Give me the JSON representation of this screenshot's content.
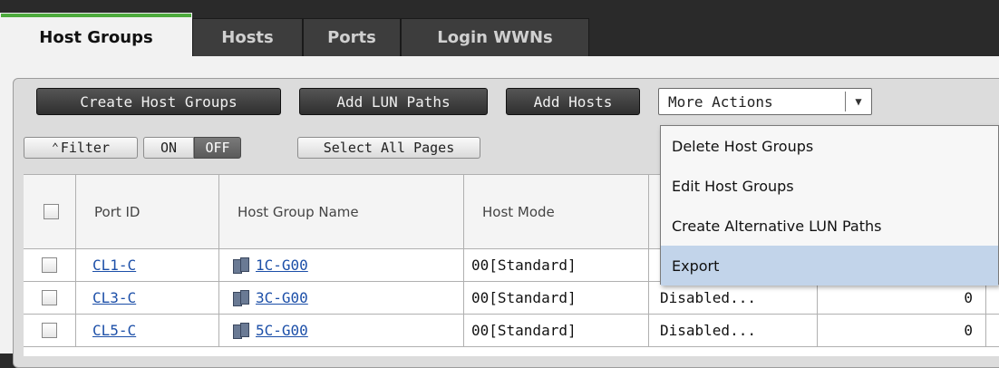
{
  "tabs": [
    {
      "label": "Host Groups",
      "active": true
    },
    {
      "label": "Hosts",
      "active": false
    },
    {
      "label": "Ports",
      "active": false
    },
    {
      "label": "Login WWNs",
      "active": false
    }
  ],
  "toolbar": {
    "create_host_groups": "Create Host Groups",
    "add_lun_paths": "Add LUN Paths",
    "add_hosts": "Add Hosts",
    "more_actions": "More Actions",
    "more_actions_caret": "▼"
  },
  "filter": {
    "filter_label": "Filter",
    "filter_icon": "chevrons-up-icon",
    "on": "ON",
    "off": "OFF",
    "select_all_pages": "Select All Pages"
  },
  "menu": {
    "items": [
      {
        "label": "Delete Host Groups",
        "highlighted": false
      },
      {
        "label": "Edit Host Groups",
        "highlighted": false
      },
      {
        "label": "Create Alternative LUN Paths",
        "highlighted": false
      },
      {
        "label": "Export",
        "highlighted": true
      }
    ]
  },
  "table": {
    "columns": [
      "Port ID",
      "Host Group Name",
      "Host Mode"
    ],
    "rows": [
      {
        "port_id": "CL1-C",
        "group": "1C-G00",
        "host_mode": "00[Standard]",
        "col4": "",
        "col5": ""
      },
      {
        "port_id": "CL3-C",
        "group": "3C-G00",
        "host_mode": "00[Standard]",
        "col4": "Disabled...",
        "col5": "0"
      },
      {
        "port_id": "CL5-C",
        "group": "5C-G00",
        "host_mode": "00[Standard]",
        "col4": "Disabled...",
        "col5": "0"
      }
    ]
  },
  "colors": {
    "accent_tab": "#4caa3c",
    "link": "#1c4fa8",
    "menu_highlight": "#c2d4ea"
  }
}
